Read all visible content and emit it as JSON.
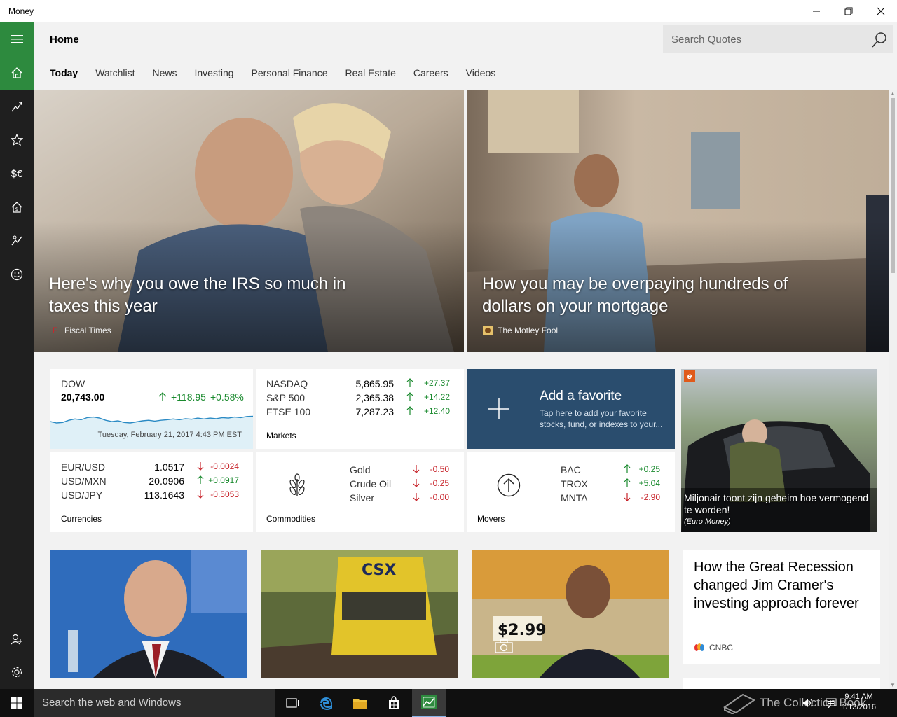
{
  "window": {
    "title": "Money"
  },
  "header": {
    "page_title": "Home",
    "search_placeholder": "Search Quotes",
    "tabs": [
      "Today",
      "Watchlist",
      "News",
      "Investing",
      "Personal Finance",
      "Real Estate",
      "Careers",
      "Videos"
    ]
  },
  "nav": {
    "currency_label": "$€"
  },
  "heroes": [
    {
      "headline": "Here's why you owe the IRS so much in taxes this year",
      "source": "Fiscal Times",
      "logo": "F"
    },
    {
      "headline": "How you may be overpaying hundreds of dollars on your mortgage",
      "source": "The Motley Fool"
    }
  ],
  "dow": {
    "name": "DOW",
    "value": "20,743.00",
    "change": "+118.95",
    "percent": "+0.58%",
    "timestamp": "Tuesday, February 21, 2017 4:43 PM EST",
    "sparkline": [
      0.55,
      0.6,
      0.58,
      0.5,
      0.45,
      0.48,
      0.4,
      0.38,
      0.42,
      0.5,
      0.55,
      0.52,
      0.58,
      0.6,
      0.56,
      0.52,
      0.5,
      0.53,
      0.5,
      0.48,
      0.45,
      0.48,
      0.44,
      0.46,
      0.42,
      0.45,
      0.42,
      0.44,
      0.4,
      0.42,
      0.38,
      0.4,
      0.36,
      0.35
    ]
  },
  "markets": {
    "label": "Markets",
    "rows": [
      {
        "name": "NASDAQ",
        "value": "5,865.95",
        "change": "+27.37",
        "dir": "up"
      },
      {
        "name": "S&P 500",
        "value": "2,365.38",
        "change": "+14.22",
        "dir": "up"
      },
      {
        "name": "FTSE 100",
        "value": "7,287.23",
        "change": "+12.40",
        "dir": "up"
      }
    ]
  },
  "favorite": {
    "title": "Add a favorite",
    "desc": "Tap here to add your favorite stocks, fund, or indexes to your..."
  },
  "currencies": {
    "label": "Currencies",
    "rows": [
      {
        "name": "EUR/USD",
        "value": "1.0517",
        "change": "-0.0024",
        "dir": "down"
      },
      {
        "name": "USD/MXN",
        "value": "20.0906",
        "change": "+0.0917",
        "dir": "up"
      },
      {
        "name": "USD/JPY",
        "value": "113.1643",
        "change": "-0.5053",
        "dir": "down"
      }
    ]
  },
  "commodities": {
    "label": "Commodities",
    "rows": [
      {
        "name": "Gold",
        "change": "-0.50",
        "dir": "down"
      },
      {
        "name": "Crude Oil",
        "change": "-0.25",
        "dir": "down"
      },
      {
        "name": "Silver",
        "change": "-0.00",
        "dir": "down"
      }
    ]
  },
  "movers": {
    "label": "Movers",
    "rows": [
      {
        "name": "BAC",
        "change": "+0.25",
        "dir": "up"
      },
      {
        "name": "TROX",
        "change": "+5.04",
        "dir": "up"
      },
      {
        "name": "MNTA",
        "change": "-2.90",
        "dir": "down"
      }
    ]
  },
  "side_story": {
    "badge": "e",
    "caption": "Miljonair toont zijn geheim hoe vermogend te worden!",
    "source": "(Euro Money)"
  },
  "text_story": {
    "headline": "How the Great Recession changed Jim Cramer's investing approach forever",
    "source": "CNBC"
  },
  "photo_tiles": [
    {
      "text": ""
    },
    {
      "text": "CSX"
    },
    {
      "text": "$2.99"
    }
  ],
  "taskbar": {
    "search_text": "Search the web and Windows",
    "time": "9:41 AM",
    "date": "1/13/2016",
    "watermark": "The Collection Book"
  },
  "colors": {
    "accent": "#2d8a3e",
    "rail": "#1f1f1f",
    "favorite_tile": "#2a4d6e",
    "up": "#1a8a2e",
    "down": "#c8252c"
  }
}
